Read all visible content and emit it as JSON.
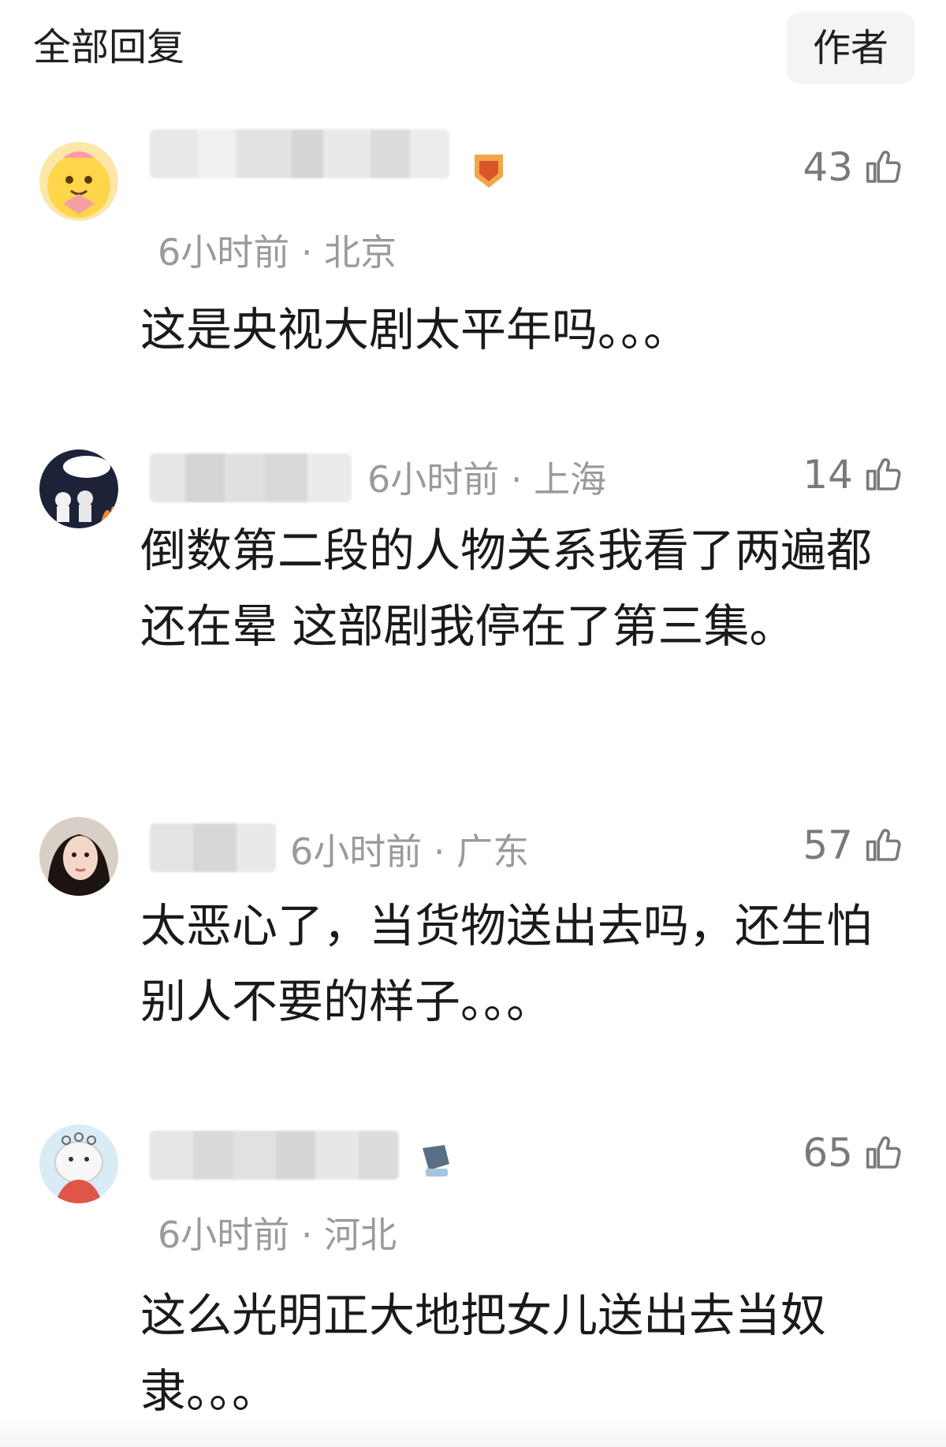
{
  "header": {
    "title": "全部回复",
    "author_label": "作者"
  },
  "comments": [
    {
      "time": "6小时前",
      "location": "北京",
      "likes": "43",
      "text": "这是央视大剧太平年吗。。。"
    },
    {
      "time": "6小时前",
      "location": "上海",
      "likes": "14",
      "text": "倒数第二段的人物关系我看了两遍都还在晕 这部剧我停在了第三集。"
    },
    {
      "time": "6小时前",
      "location": "广东",
      "likes": "57",
      "text": "太恶心了，当货物送出去吗，还生怕别人不要的样子。。。"
    },
    {
      "time": "6小时前",
      "location": "河北",
      "likes": "65",
      "text": "这么光明正大地把女儿送出去当奴隶。。。"
    }
  ],
  "icons": {
    "like": "thumbs-up-icon"
  },
  "colors": {
    "meta_text": "#9a9a9a",
    "likes_text": "#7a7a7a",
    "body_text": "#1a1a1a",
    "author_button_bg": "#f4f4f4"
  }
}
